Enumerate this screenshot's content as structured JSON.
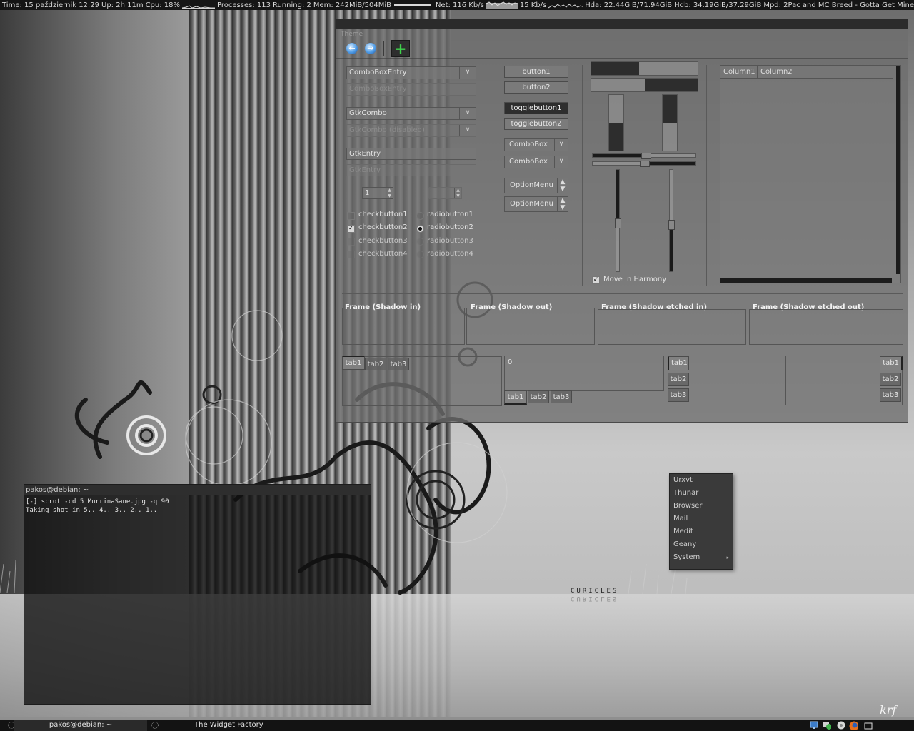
{
  "conky": {
    "time": "Time: 15 październik 12:29",
    "uptime": "Up: 2h 11m",
    "cpu": "Cpu:  18%",
    "processes": "Processes: 113",
    "running": "Running: 2",
    "mem": "Mem: 242MiB/504MiB",
    "net": "Net: 116 Kb/s",
    "net_up": "15 Kb/s",
    "hda": "Hda: 22.44GiB/71.94GiB",
    "hdb": "Hdb: 34.19GiB/37.29GiB",
    "mpd": "Mpd:  2Pac and MC Breed - Gotta Get Mine"
  },
  "widget_factory": {
    "menu": "Theme",
    "toolbar": {
      "back_icon": "back-arrow-icon",
      "forward_icon": "forward-arrow-icon",
      "add_icon": "add-plus-icon"
    },
    "combo_entry": "ComboBoxEntry",
    "combo_entry_disabled": "ComboBoxEntry",
    "gtk_combo": "GtkCombo",
    "gtk_combo_disabled": "GtkCombo (disabled)",
    "gtk_entry": "GtkEntry",
    "gtk_entry_disabled": "GtkEntry",
    "spin_value": "1",
    "spin_value_disabled": "",
    "checks": [
      {
        "label": "checkbutton1",
        "checked": false
      },
      {
        "label": "checkbutton2",
        "checked": true
      },
      {
        "label": "checkbutton3",
        "checked": false
      },
      {
        "label": "checkbutton4",
        "checked": false
      }
    ],
    "radios": [
      {
        "label": "radiobutton1",
        "checked": false
      },
      {
        "label": "radiobutton2",
        "checked": true
      },
      {
        "label": "radiobutton3",
        "checked": false
      },
      {
        "label": "radiobutton4",
        "checked": false
      }
    ],
    "button1": "button1",
    "button2": "button2",
    "toggle1": "togglebutton1",
    "toggle2": "togglebutton2",
    "combobox1": "ComboBox",
    "combobox2": "ComboBox",
    "optionmenu1": "OptionMenu",
    "optionmenu2": "OptionMenu",
    "progress": {
      "horizontal_1": 0.45,
      "horizontal_2": 0.55,
      "vertical_1": 0.5,
      "vertical_2": 0.5
    },
    "move_in_harmony": "Move In Harmony",
    "columns": [
      "Column1",
      "Column2"
    ],
    "frames": [
      "Frame (Shadow in)",
      "Frame (Shadow out)",
      "Frame (Shadow etched in)",
      "Frame (Shadow etched out)"
    ],
    "tabs": [
      "tab1",
      "tab2",
      "tab3"
    ],
    "tab_content_value": "0"
  },
  "terminal": {
    "title": "pakos@debian: ~",
    "line1": "[-] scrot -cd 5 MurrinaSane.jpg -q 90",
    "line2": "Taking shot in 5.. 4.. 3.. 2.. 1.."
  },
  "popup_menu": [
    "Urxvt",
    "Thunar",
    "Browser",
    "Mail",
    "Medit",
    "Geany",
    "System"
  ],
  "wallpaper": {
    "text1": "CURICLES",
    "text2": "CURICLES"
  },
  "panel": {
    "task1": "pakos@debian: ~",
    "task2": "The Widget Factory"
  },
  "colors": {
    "panel_bg": "#131313",
    "accent_green": "#3fd24b",
    "accent_blue": "#4e9be6"
  }
}
